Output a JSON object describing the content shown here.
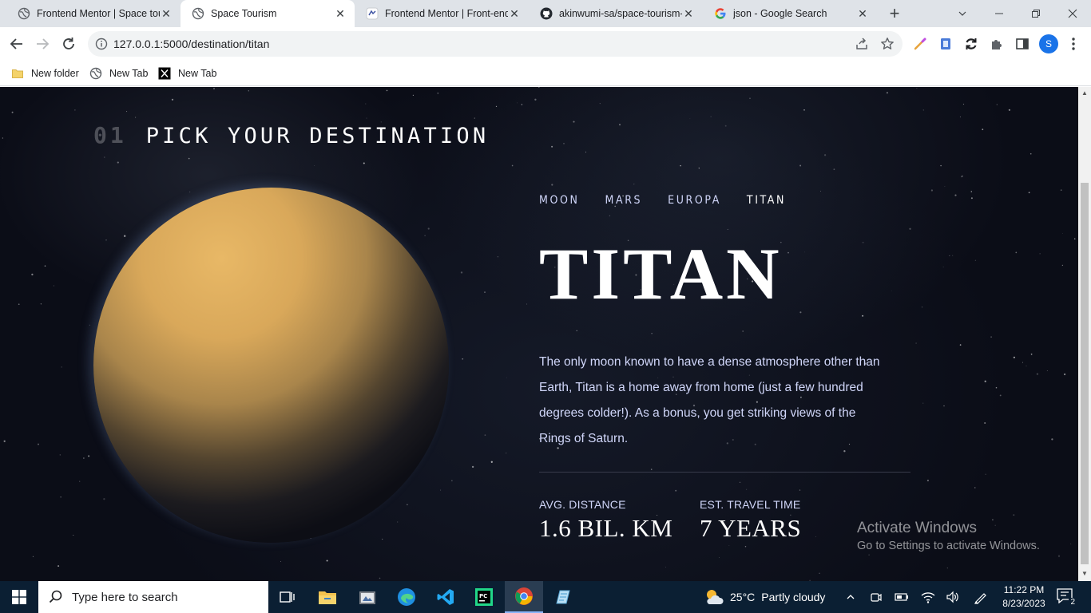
{
  "browser": {
    "tabs": [
      {
        "title": "Frontend Mentor | Space tou",
        "favicon": "globe-icon"
      },
      {
        "title": "Space Tourism",
        "favicon": "globe-icon"
      },
      {
        "title": "Frontend Mentor | Front-end",
        "favicon": "frontend-mentor-icon"
      },
      {
        "title": "akinwumi-sa/space-tourism-",
        "favicon": "github-icon"
      },
      {
        "title": "json - Google Search",
        "favicon": "google-icon"
      }
    ],
    "active_tab_index": 1,
    "url": "127.0.0.1:5000/destination/titan",
    "profile_initial": "S",
    "bookmarks": [
      {
        "label": "New folder",
        "icon": "folder-icon"
      },
      {
        "label": "New Tab",
        "icon": "globe-icon"
      },
      {
        "label": "New Tab",
        "icon": "x-logo-icon"
      }
    ]
  },
  "page": {
    "heading_number": "01",
    "heading_text": "PICK YOUR DESTINATION",
    "destinations": [
      "MOON",
      "MARS",
      "EUROPA",
      "TITAN"
    ],
    "active_destination": "TITAN",
    "name": "TITAN",
    "description": "The only moon known to have a dense atmosphere other than Earth, Titan is a home away from home (just a few hundred degrees colder!). As a bonus, you get striking views of the Rings of Saturn.",
    "stats": [
      {
        "label": "AVG. DISTANCE",
        "value": "1.6 BIL. KM"
      },
      {
        "label": "EST. TRAVEL TIME",
        "value": "7 YEARS"
      }
    ]
  },
  "watermark": {
    "title": "Activate Windows",
    "subtitle": "Go to Settings to activate Windows."
  },
  "taskbar": {
    "search_placeholder": "Type here to search",
    "weather_temp": "25°C",
    "weather_desc": "Partly cloudy",
    "time": "11:22 PM",
    "date": "8/23/2023",
    "notification_count": "2"
  },
  "colors": {
    "page_background": "#0b0d17",
    "text_light_blue": "#d0d6f9",
    "text_white": "#ffffff",
    "taskbar": "#0b1f33"
  }
}
